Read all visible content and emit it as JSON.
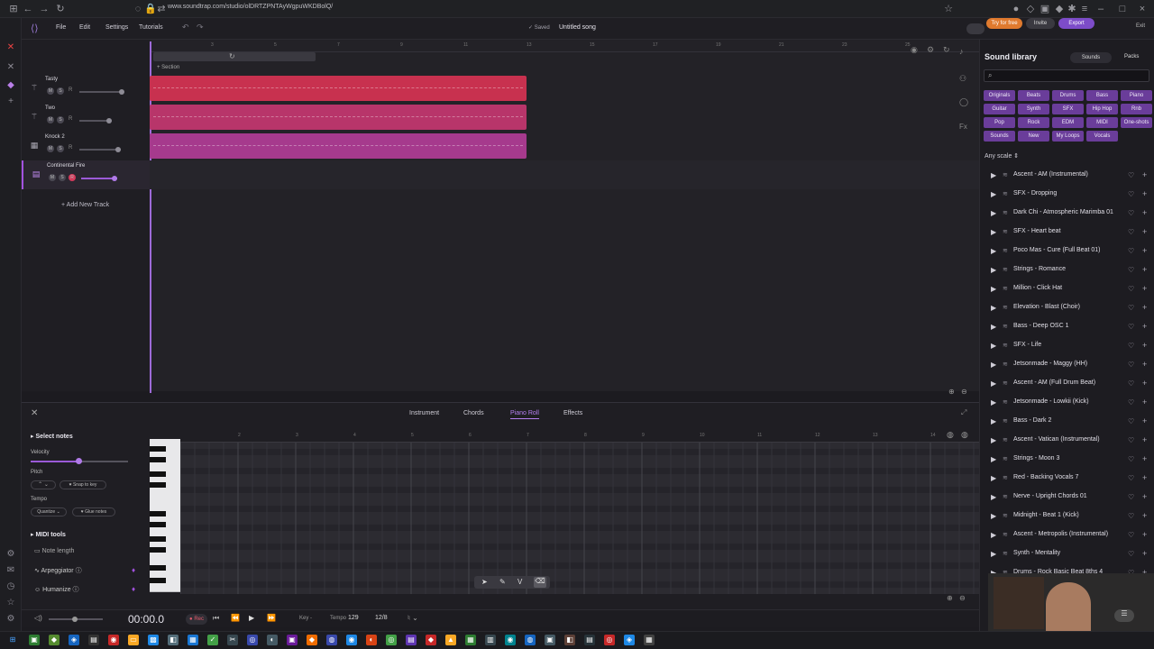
{
  "browser": {
    "url": "www.soundtrap.com/studio/olDRTZPNTAyWgpuWKDBolQ/"
  },
  "header": {
    "menu": [
      "File",
      "Edit",
      "Settings",
      "Tutorials"
    ],
    "saved": "Saved",
    "song_title": "Untitled song",
    "try_free": "Try for free",
    "invite": "Invite",
    "export": "Export",
    "exit": "Exit"
  },
  "tracks": [
    {
      "name": "Tasty",
      "color": "#c8314f"
    },
    {
      "name": "Two",
      "color": "#b8356a"
    },
    {
      "name": "Knock 2",
      "color": "#a63a8d"
    },
    {
      "name": "Continental Fire",
      "color": "#8a3ca7"
    }
  ],
  "add_track": "Add New Track",
  "section_label": "Section",
  "ruler_numbers": [
    "3",
    "5",
    "7",
    "9",
    "11",
    "13",
    "15",
    "17",
    "19",
    "21",
    "23",
    "25",
    "27"
  ],
  "library": {
    "title": "Sound library",
    "sounds_tab": "Sounds",
    "packs_tab": "Packs",
    "tags": [
      "Originals",
      "Beats",
      "Drums",
      "Bass",
      "Piano",
      "Guitar",
      "Synth",
      "SFX",
      "Hip Hop",
      "Rnb",
      "Pop",
      "Rock",
      "EDM",
      "MIDI",
      "One-shots",
      "Sounds",
      "New",
      "My Loops",
      "Vocals"
    ],
    "scale": "Any scale",
    "items": [
      "Ascent - AM (Instrumental)",
      "SFX - Dropping",
      "Dark Chi - Atmospheric Marimba 01",
      "SFX - Heart beat",
      "Poco Mas - Cure (Full Beat 01)",
      "Strings - Romance",
      "Million - Click Hat",
      "Elevation - Blast (Choir)",
      "Bass - Deep OSC 1",
      "SFX - Life",
      "Jetsonmade - Maggy (HH)",
      "Ascent - AM (Full Drum Beat)",
      "Jetsonmade - Lowkii (Kick)",
      "Bass - Dark 2",
      "Ascent - Vatican (Instrumental)",
      "Strings - Moon 3",
      "Red - Backing Vocals 7",
      "Nerve - Upright Chords 01",
      "Midnight - Beat 1 (Kick)",
      "Ascent - Metropolis (Instrumental)",
      "Synth - Mentality",
      "Drums - Rock Basic Beat 8ths 4"
    ]
  },
  "panel": {
    "tabs": [
      "Instrument",
      "Chords",
      "Piano Roll",
      "Effects"
    ],
    "active_tab": "Piano Roll",
    "select_notes": "Select notes",
    "velocity": "Velocity",
    "pitch": "Pitch",
    "snap_to_key": "Snap to key",
    "tempo": "Tempo",
    "quantize": "Quantize",
    "glue_notes": "Glue notes",
    "midi_tools": "MIDI tools",
    "note_length": "Note length",
    "arpeggiator": "Arpeggiator",
    "humanize": "Humanize",
    "bar_numbers": [
      "2",
      "3",
      "4",
      "5",
      "6",
      "7",
      "8",
      "9",
      "10",
      "11",
      "12",
      "13",
      "14"
    ]
  },
  "transport": {
    "time": "00:00.0",
    "rec": "Rec",
    "key_label": "Key",
    "tempo_label": "Tempo",
    "tempo_value": "129",
    "signature": "12/8"
  }
}
